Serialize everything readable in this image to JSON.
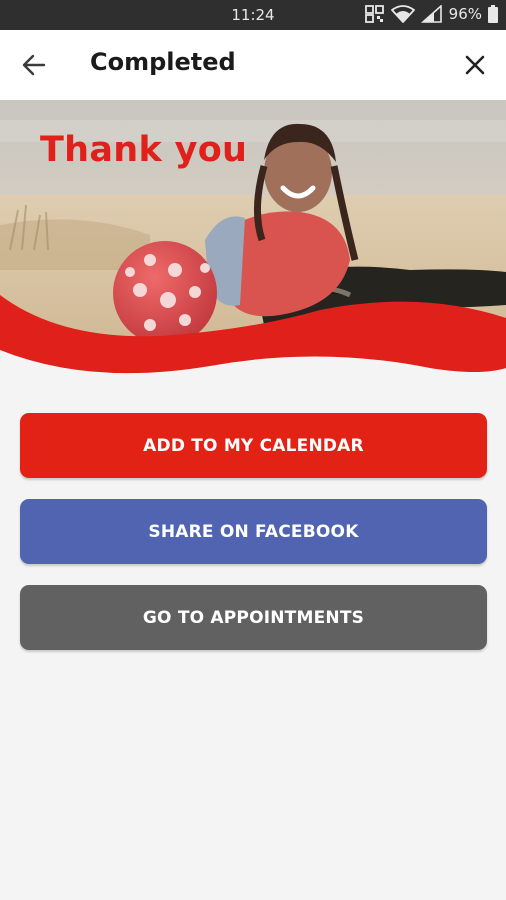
{
  "statusbar": {
    "time": "11:24",
    "battery": "96%"
  },
  "header": {
    "title": "Completed",
    "back_icon": "arrow-left-icon",
    "close_icon": "close-icon"
  },
  "hero": {
    "headline": "Thank you",
    "accent_color": "#e0201a"
  },
  "actions": {
    "calendar_label": "ADD TO MY CALENDAR",
    "facebook_label": "SHARE ON FACEBOOK",
    "appointments_label": "GO TO APPOINTMENTS"
  },
  "colors": {
    "primary": "#e32216",
    "facebook": "#5064b1",
    "neutral": "#616161"
  }
}
